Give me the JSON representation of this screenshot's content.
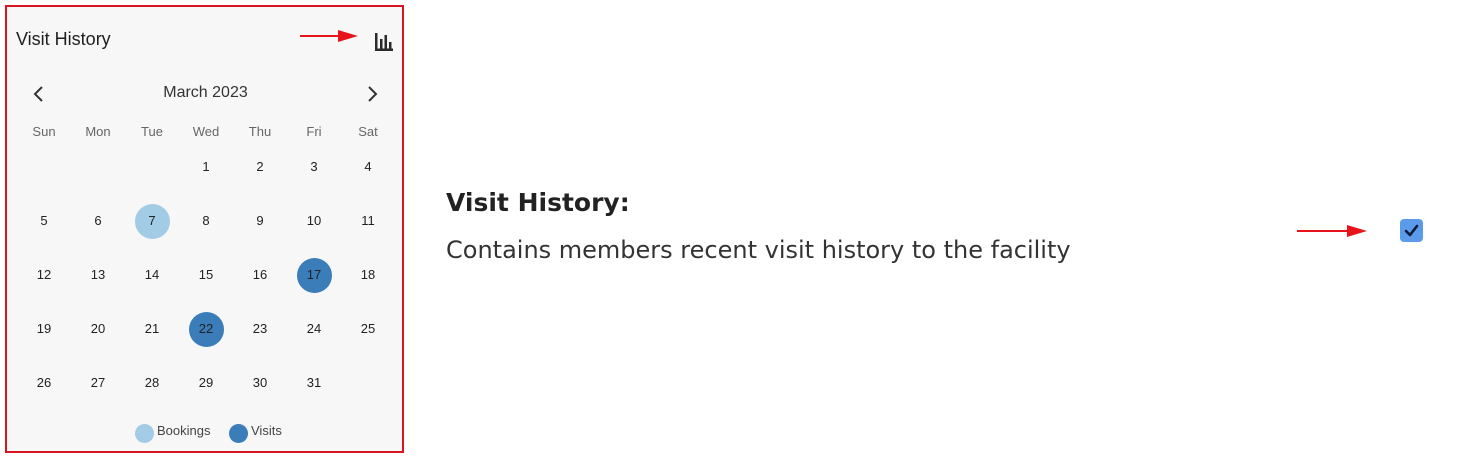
{
  "card": {
    "title": "Visit History",
    "month_label": "March 2023",
    "weekdays": [
      "Sun",
      "Mon",
      "Tue",
      "Wed",
      "Thu",
      "Fri",
      "Sat"
    ],
    "first_weekday_index": 3,
    "days_in_month": 31,
    "highlights": [
      {
        "day": 7,
        "type": "booking"
      },
      {
        "day": 17,
        "type": "visit"
      },
      {
        "day": 22,
        "type": "visit"
      }
    ],
    "legend": [
      {
        "label": "Bookings",
        "color": "#a2cbe6"
      },
      {
        "label": "Visits",
        "color": "#3a7db8"
      }
    ]
  },
  "info": {
    "title": "Visit History:",
    "description": "Contains members recent visit history to the facility",
    "checkbox_checked": true
  },
  "colors": {
    "annotation": "#e8141b",
    "booking": "#a2cbe6",
    "visit": "#3a7db8",
    "checkbox": "#5b9bea"
  }
}
